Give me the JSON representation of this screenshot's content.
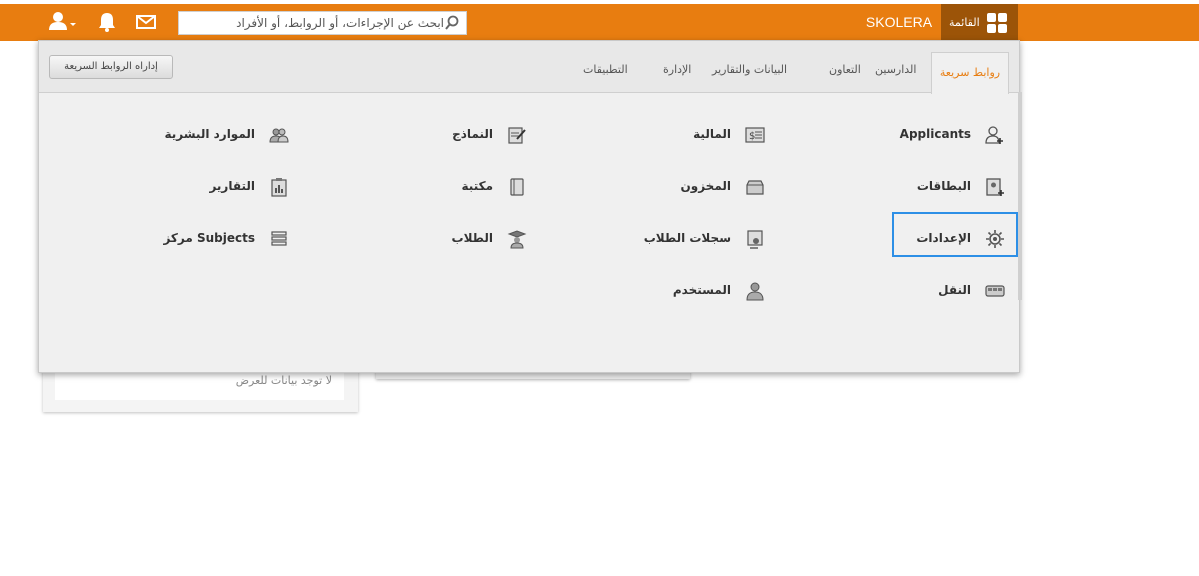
{
  "topbar": {
    "search_text": "ابحث عن الإجراءات، أو الروابط، أو الأفراد",
    "brand": "SKOLERA",
    "menu_label": "القائمة",
    "colors": {
      "bar": "#e87d10",
      "menu_button": "#9c5408"
    }
  },
  "tabs": [
    {
      "label": "روابط سريعة",
      "active": true
    },
    {
      "label": "الدارسين"
    },
    {
      "label": "التعاون"
    },
    {
      "label": "البيانات والتقارير"
    },
    {
      "label": "الإدارة"
    },
    {
      "label": "التطبيقات"
    }
  ],
  "manage_button": "إداراه الروابط السريعة",
  "quicklinks": {
    "col1": [
      {
        "label": "Applicants",
        "icon": "user-add-icon"
      },
      {
        "label": "البطاقات",
        "icon": "card-add-icon"
      },
      {
        "label": "الإعدادات",
        "icon": "gear-icon"
      },
      {
        "label": "النقل",
        "icon": "bus-icon"
      }
    ],
    "col2": [
      {
        "label": "المالية",
        "icon": "money-icon"
      },
      {
        "label": "المخزون",
        "icon": "box-icon"
      },
      {
        "label": "سجلات الطلاب",
        "icon": "student-record-icon"
      },
      {
        "label": "المستخدم",
        "icon": "user-icon"
      }
    ],
    "col3": [
      {
        "label": "النماذج",
        "icon": "form-icon"
      },
      {
        "label": "مكتبة",
        "icon": "library-icon"
      },
      {
        "label": "الطلاب",
        "icon": "graduate-icon"
      }
    ],
    "col4": [
      {
        "label": "الموارد البشرية",
        "icon": "people-icon"
      },
      {
        "label": "التقارير",
        "icon": "report-icon"
      },
      {
        "label": "Subjects مركز",
        "icon": "list-icon"
      }
    ]
  },
  "background": {
    "empty_text": "لا توجد بيانات للعرض"
  }
}
